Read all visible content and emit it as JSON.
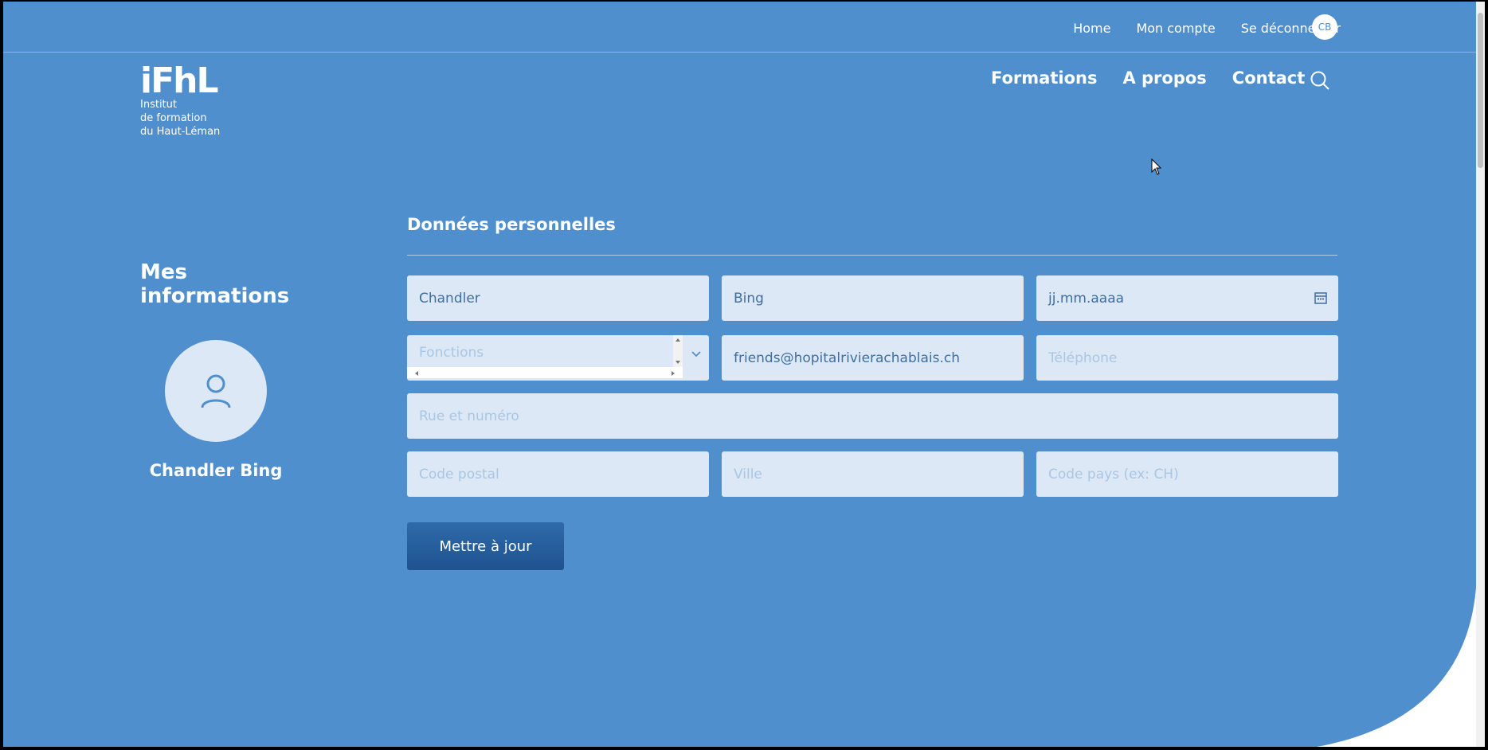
{
  "topnav": {
    "home": "Home",
    "account": "Mon compte",
    "logout": "Se déconnecter",
    "avatar_initials": "CB"
  },
  "logo": {
    "mark": "iFhL",
    "line1": "Institut",
    "line2": "de formation",
    "line3": "du Haut-Léman"
  },
  "mainnav": {
    "formations": "Formations",
    "about": "A propos",
    "contact": "Contact"
  },
  "profile": {
    "section_title": "Mes informations",
    "name": "Chandler Bing"
  },
  "form": {
    "title": "Données personnelles",
    "first_name": "Chandler",
    "last_name": "Bing",
    "birthdate_placeholder": "jj.mm.aaaa",
    "functions_placeholder": "Fonctions",
    "email": "friends@hopitalrivierachablais.ch",
    "phone_placeholder": "Téléphone",
    "street_placeholder": "Rue et numéro",
    "postal_placeholder": "Code postal",
    "city_placeholder": "Ville",
    "country_placeholder": "Code pays (ex: CH)",
    "submit_label": "Mettre à jour"
  },
  "colors": {
    "background": "#4f8fce",
    "field": "#dce8f5",
    "button": "#1f5390"
  },
  "icons": [
    "search-icon",
    "user-icon",
    "calendar-icon",
    "chevron-down-icon",
    "cursor-icon"
  ]
}
